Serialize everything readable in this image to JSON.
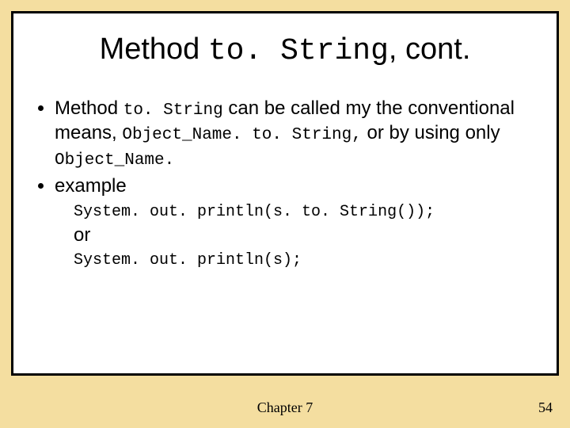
{
  "title": {
    "pre": "Method ",
    "code": "to. String",
    "post": ", cont."
  },
  "bullets": [
    {
      "parts": [
        {
          "t": "Method ",
          "mono": false
        },
        {
          "t": "to. String",
          "mono": true
        },
        {
          "t": " can be called my the conventional means, ",
          "mono": false
        },
        {
          "t": "Object_Name. to. String,",
          "mono": true
        },
        {
          "t": " or by using only ",
          "mono": false
        },
        {
          "t": "Object_Name.",
          "mono": true
        }
      ]
    },
    {
      "parts": [
        {
          "t": "example",
          "mono": false
        }
      ]
    }
  ],
  "code1": "System. out. println(s. to. String());",
  "or": "or",
  "code2": "System. out. println(s);",
  "footer": {
    "center": "Chapter 7",
    "page": "54"
  }
}
